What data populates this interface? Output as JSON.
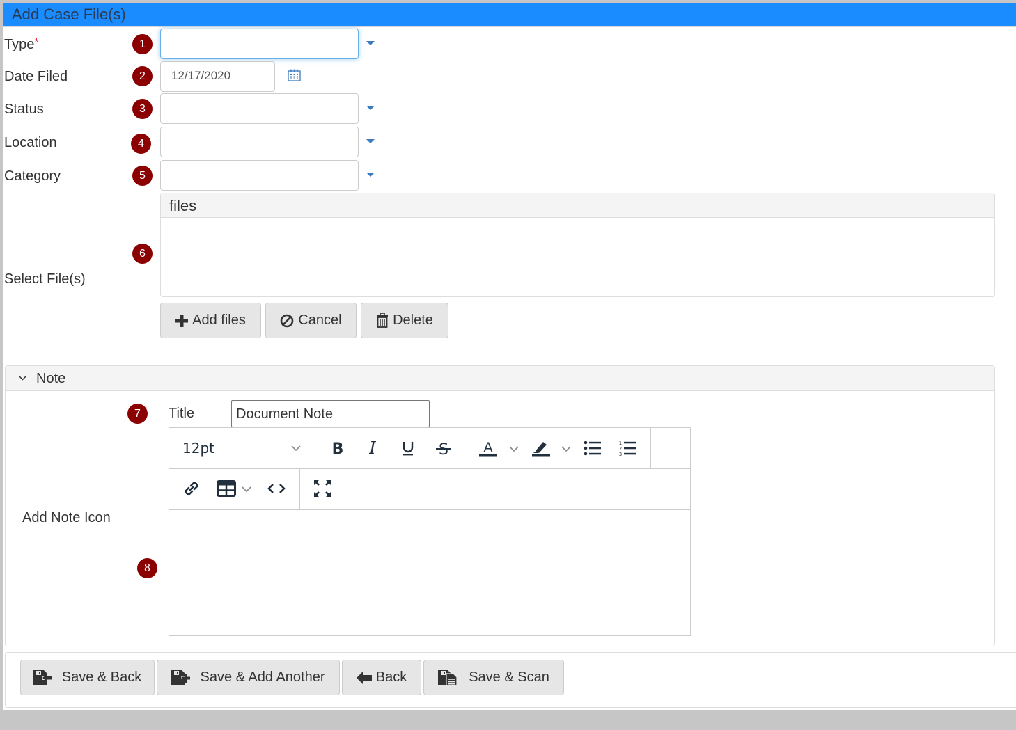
{
  "window": {
    "title": "Add Case File(s)"
  },
  "fields": [
    {
      "label": "Type",
      "required_mark": "*",
      "step": "1",
      "value": ""
    },
    {
      "label": "Date Filed",
      "step": "2",
      "value": "12/17/2020"
    },
    {
      "label": "Status",
      "step": "3",
      "value": ""
    },
    {
      "label": "Location",
      "step": "4",
      "value": ""
    },
    {
      "label": "Category",
      "step": "5",
      "value": ""
    }
  ],
  "files": {
    "label": "Select File(s)",
    "step": "6",
    "panel_header": "files",
    "buttons": {
      "add": "Add files",
      "cancel": "Cancel",
      "delete": "Delete"
    }
  },
  "note": {
    "section_title": "Note",
    "step_title": "7",
    "title_label": "Title",
    "title_value": "Document Note",
    "add_note_label": "Add Note Icon",
    "step_editor": "8",
    "editor": {
      "font_size": "12pt",
      "toolbar_icons": [
        "bold-icon",
        "italic-icon",
        "underline-icon",
        "strikethrough-icon",
        "text-color-icon",
        "highlight-icon",
        "bullet-list-icon",
        "numbered-list-icon",
        "link-icon",
        "table-icon",
        "source-code-icon",
        "fullscreen-icon"
      ],
      "content": ""
    }
  },
  "footer": {
    "buttons": {
      "save_back": "Save & Back",
      "save_add": "Save & Add Another",
      "back": "Back",
      "save_scan": "Save & Scan"
    }
  },
  "colors": {
    "titlebar": "#1a8cff",
    "badge": "#8b0000",
    "required": "#e0262b",
    "caret": "#3b7bbf"
  }
}
